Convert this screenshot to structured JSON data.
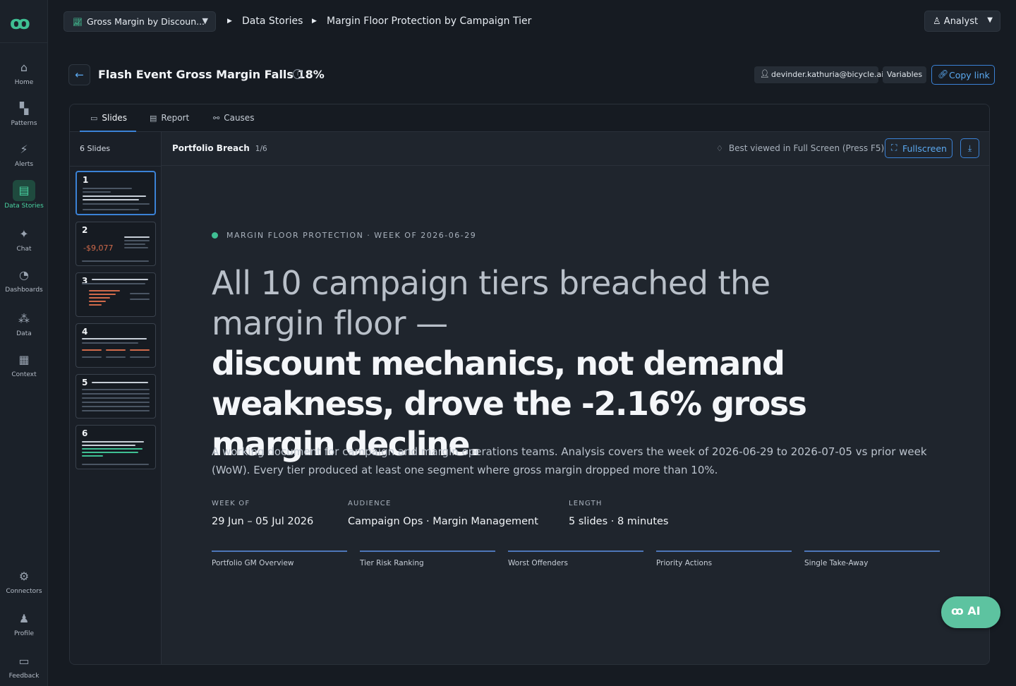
{
  "sidebar": {
    "logo": "ꝏ",
    "items": [
      {
        "label": "Home",
        "icon": "⌂"
      },
      {
        "label": "Patterns",
        "icon": "▚"
      },
      {
        "label": "Alerts",
        "icon": "⚡"
      },
      {
        "label": "Data Stories",
        "icon": "▤"
      },
      {
        "label": "Chat",
        "icon": "✦"
      },
      {
        "label": "Dashboards",
        "icon": "◔"
      },
      {
        "label": "Data",
        "icon": "⁂"
      },
      {
        "label": "Context",
        "icon": "▦"
      }
    ],
    "bottom_items": [
      {
        "label": "Connectors",
        "icon": "⚙"
      },
      {
        "label": "Profile",
        "icon": "♟"
      },
      {
        "label": "Feedback",
        "icon": "▭"
      }
    ]
  },
  "topbar": {
    "story_select": "Gross Margin by Discoun...",
    "breadcrumb": [
      "Data Stories",
      "Margin Floor Protection by Campaign Tier"
    ],
    "role": "Analyst"
  },
  "header": {
    "title": "Flash Event Gross Margin Falls 18%",
    "user": "devinder.kathuria@bicycle.ai",
    "variables_label": "Variables",
    "copy_link_label": "Copy link"
  },
  "tabs": [
    {
      "label": "Slides",
      "icon": "▭"
    },
    {
      "label": "Report",
      "icon": "▤"
    },
    {
      "label": "Causes",
      "icon": "⚯"
    }
  ],
  "thumbs": {
    "count_label": "6 Slides",
    "items": [
      {
        "num": "1"
      },
      {
        "num": "2",
        "value": "-$9,077"
      },
      {
        "num": "3"
      },
      {
        "num": "4"
      },
      {
        "num": "5"
      },
      {
        "num": "6"
      }
    ]
  },
  "slide_header": {
    "name": "Portfolio Breach",
    "counter": "1/6",
    "hint": "Best viewed in Full Screen (Press F5)",
    "fullscreen_label": "Fullscreen"
  },
  "slide": {
    "eyebrow": "MARGIN FLOOR PROTECTION · WEEK OF 2026-06-29",
    "headline_light": "All 10 campaign tiers breached the margin floor —",
    "headline_bold": "discount mechanics, not demand weakness, drove the -2.16% gross margin decline.",
    "summary": "A working document for campaign and margin operations teams. Analysis covers the week of 2026-06-29 to 2026-07-05 vs prior week (WoW). Every tier produced at least one segment where gross margin dropped more than 10%.",
    "meta": [
      {
        "label": "WEEK OF",
        "value": "29 Jun – 05 Jul 2026"
      },
      {
        "label": "AUDIENCE",
        "value": "Campaign Ops · Margin Management"
      },
      {
        "label": "LENGTH",
        "value": "5 slides · 8 minutes"
      }
    ],
    "sections": [
      "Portfolio GM Overview",
      "Tier Risk Ranking",
      "Worst Offenders",
      "Priority Actions",
      "Single Take-Away"
    ]
  },
  "ai_button": {
    "label": "AI",
    "icon": "ꝏ"
  },
  "colors": {
    "accent": "#49d3a1",
    "link": "#5ba9f0",
    "background": "#161b22"
  }
}
